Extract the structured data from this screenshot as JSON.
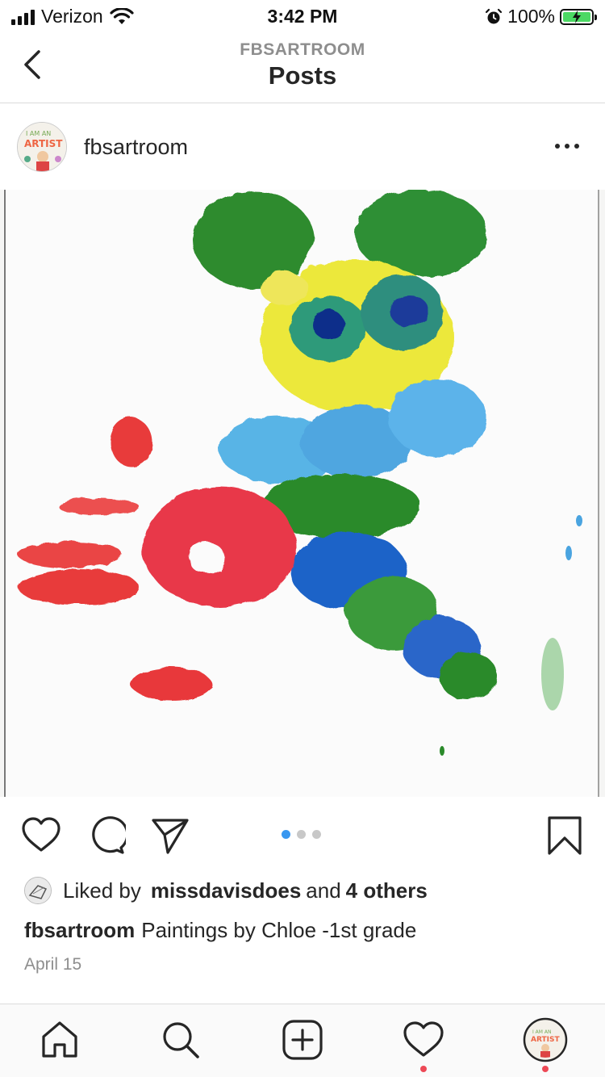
{
  "status_bar": {
    "carrier": "Verizon",
    "time": "3:42 PM",
    "battery": "100%",
    "icons": [
      "signal-icon",
      "wifi-icon",
      "alarm-icon",
      "battery-charging-icon"
    ]
  },
  "nav": {
    "subtitle": "FBSARTROOM",
    "title": "Posts",
    "back_icon": "chevron-left-icon"
  },
  "post": {
    "username": "fbsartroom",
    "avatar_text": "I AM AN ARTIST",
    "more_icon": "more-horizontal-icon",
    "image_alt": "Child's finger painting with red handprint, green, yellow and blue paint blobs",
    "carousel": {
      "count": 3,
      "active_index": 1
    },
    "actions": {
      "like_icon": "heart-icon",
      "comment_icon": "comment-icon",
      "share_icon": "send-icon",
      "save_icon": "bookmark-icon"
    },
    "likes": {
      "prefix": "Liked by",
      "user": "missdavisdoes",
      "joiner": "and",
      "others": "4 others"
    },
    "caption": {
      "user": "fbsartroom",
      "text": "Paintings by Chloe -1st grade"
    },
    "date": "April 15"
  },
  "tab_bar": {
    "items": [
      {
        "name": "home",
        "icon": "home-icon",
        "notification": false
      },
      {
        "name": "search",
        "icon": "search-icon",
        "notification": false
      },
      {
        "name": "new-post",
        "icon": "plus-square-icon",
        "notification": false
      },
      {
        "name": "activity",
        "icon": "heart-icon",
        "notification": true
      },
      {
        "name": "profile",
        "icon": "avatar-icon",
        "notification": true
      }
    ]
  },
  "colors": {
    "accent": "#3897f0",
    "notification": "#ed4956",
    "text": "#262626",
    "muted": "#8e8e8e"
  }
}
